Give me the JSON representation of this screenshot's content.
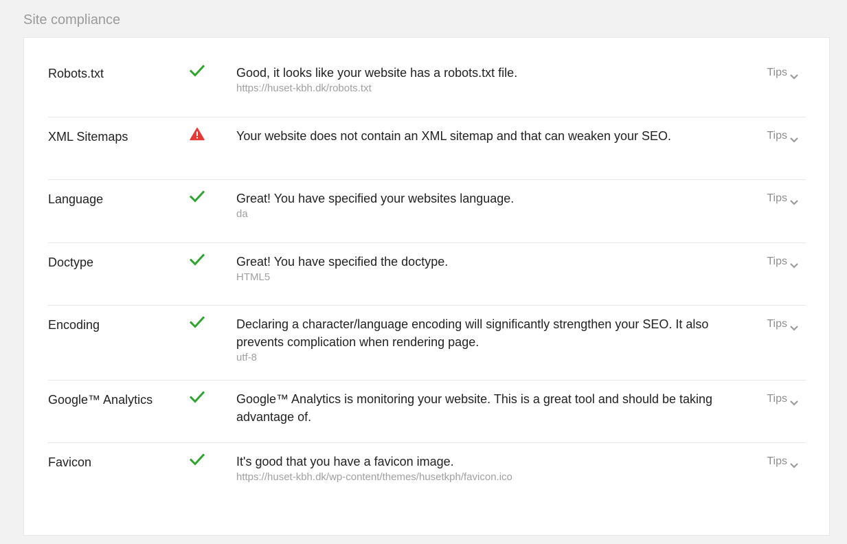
{
  "section": {
    "title": "Site compliance"
  },
  "colors": {
    "check": "#2fa32f",
    "warning": "#e53935",
    "muted": "#a0a0a0"
  },
  "rows": [
    {
      "label": "Robots.txt",
      "status": "check-icon",
      "message": "Good, it looks like your website has a robots.txt file.",
      "detail": "https://huset-kbh.dk/robots.txt",
      "tips": "Tips"
    },
    {
      "label": "XML Sitemaps",
      "status": "warning-icon",
      "message": "Your website does not contain an XML sitemap and that can weaken your SEO.",
      "detail": "",
      "tips": "Tips"
    },
    {
      "label": "Language",
      "status": "check-icon",
      "message": "Great! You have specified your websites language.",
      "detail": "da",
      "tips": "Tips"
    },
    {
      "label": "Doctype",
      "status": "check-icon",
      "message": "Great! You have specified the doctype.",
      "detail": "HTML5",
      "tips": "Tips"
    },
    {
      "label": "Encoding",
      "status": "check-icon",
      "message": "Declaring a character/language encoding will significantly strengthen your SEO. It also prevents complication when rendering page.",
      "detail": "utf-8",
      "tips": "Tips"
    },
    {
      "label": "Google™ Analytics",
      "status": "check-icon",
      "message": "Google™ Analytics is monitoring your website. This is a great tool and should be taking advantage of.",
      "detail": "",
      "tips": "Tips"
    },
    {
      "label": "Favicon",
      "status": "check-icon",
      "message": "It's good that you have a favicon image.",
      "detail": "https://huset-kbh.dk/wp-content/themes/husetkph/favicon.ico",
      "tips": "Tips"
    }
  ]
}
